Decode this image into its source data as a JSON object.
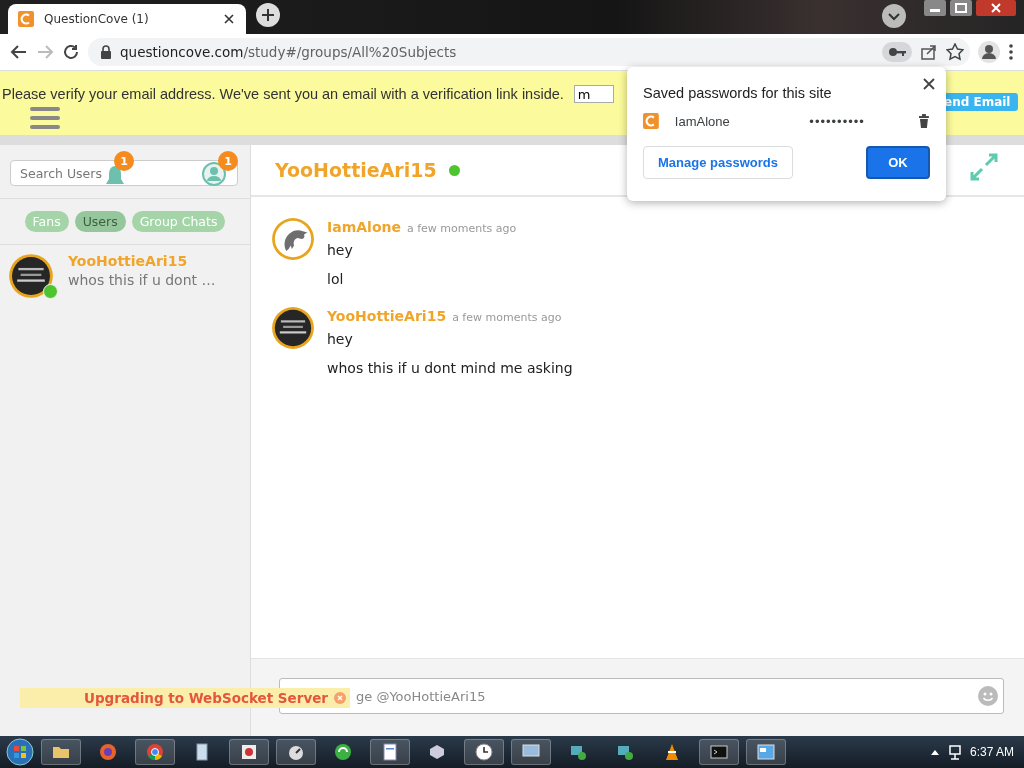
{
  "browser": {
    "tab": {
      "title": "QuestionCove (1)"
    },
    "url": {
      "host": "questioncove.com",
      "path": "/study#/groups/All%20Subjects"
    }
  },
  "banner": {
    "message": "Please verify your email address. We've sent you an email with a verification link inside.",
    "field_value": "m",
    "button": "end Email"
  },
  "sidebar": {
    "search": {
      "placeholder": "Search Users"
    },
    "badges": [
      "1",
      "1"
    ],
    "filters": [
      {
        "label": "Fans",
        "selected": false
      },
      {
        "label": "Users",
        "selected": true
      },
      {
        "label": "Group Chats",
        "selected": false
      }
    ],
    "conversations": [
      {
        "name": "YooHottieAri15",
        "preview": "whos this if u dont …",
        "online": true
      }
    ]
  },
  "chat": {
    "title": "YooHottieAri15",
    "online": true,
    "messages": [
      {
        "author": "IamAlone",
        "time": "a few moments ago",
        "avatar": {
          "kind": "dolphin"
        },
        "lines": [
          "hey",
          "lol"
        ]
      },
      {
        "author": "YooHottieAri15",
        "time": "a few moments ago",
        "avatar": {
          "kind": "picture"
        },
        "lines": [
          "hey",
          "whos this if u dont mind me asking"
        ]
      }
    ],
    "composer": {
      "placeholder": "ge @YooHottieAri15"
    }
  },
  "toast": {
    "text": "Upgrading to WebSocket Server"
  },
  "password_popup": {
    "title": "Saved passwords for this site",
    "username": "IamAlone",
    "password": "••••••••••",
    "manage_button": "Manage passwords",
    "ok_button": "OK"
  },
  "taskbar": {
    "time": "6:37 AM"
  }
}
